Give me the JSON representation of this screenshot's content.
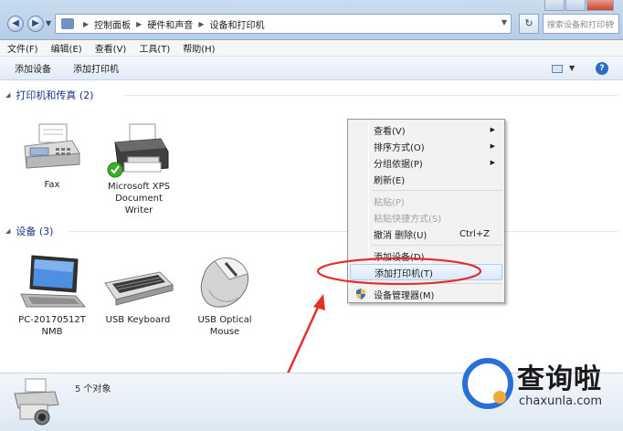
{
  "address": {
    "crumbs": [
      "控制面板",
      "硬件和声音",
      "设备和打印机"
    ],
    "search_placeholder": "搜索设备和打印机",
    "refresh_glyph": "↻"
  },
  "menu": {
    "items": [
      "文件(F)",
      "编辑(E)",
      "查看(V)",
      "工具(T)",
      "帮助(H)"
    ]
  },
  "toolbar": {
    "add_device": "添加设备",
    "add_printer": "添加打印机",
    "help_glyph": "?"
  },
  "sections": {
    "printers": {
      "title": "打印机和传真 (2)"
    },
    "devices": {
      "title": "设备 (3)"
    }
  },
  "printers": [
    {
      "label": "Fax",
      "icon": "fax-icon"
    },
    {
      "label": "Microsoft XPS Document Writer",
      "icon": "printer-icon",
      "default": true
    }
  ],
  "devices": [
    {
      "label": "PC-20170512TNMB",
      "icon": "laptop-icon"
    },
    {
      "label": "USB Keyboard",
      "icon": "keyboard-icon"
    },
    {
      "label": "USB Optical Mouse",
      "icon": "mouse-icon"
    }
  ],
  "context_menu": {
    "items": [
      {
        "label": "查看(V)",
        "submenu": true,
        "enabled": true
      },
      {
        "label": "排序方式(O)",
        "submenu": true,
        "enabled": true
      },
      {
        "label": "分组依据(P)",
        "submenu": true,
        "enabled": true
      },
      {
        "label": "刷新(E)",
        "submenu": false,
        "enabled": true
      },
      {
        "label": "粘贴(P)",
        "submenu": false,
        "enabled": false
      },
      {
        "label": "粘贴快捷方式(S)",
        "submenu": false,
        "enabled": false
      },
      {
        "label": "撤消 删除(U)",
        "shortcut": "Ctrl+Z",
        "enabled": true
      },
      {
        "label": "添加设备(D)",
        "enabled": true
      },
      {
        "label": "添加打印机(T)",
        "enabled": true,
        "highlighted": true
      },
      {
        "label": "设备管理器(M)",
        "enabled": true,
        "icon": "shield-icon"
      }
    ]
  },
  "details": {
    "count": "5 个对象"
  },
  "watermark": {
    "brand": "查询啦",
    "url": "chaxunla.com"
  },
  "colors": {
    "annotation": "#e0322b",
    "section_heading": "#1e3287",
    "brand_blue": "#2a6fd8"
  }
}
